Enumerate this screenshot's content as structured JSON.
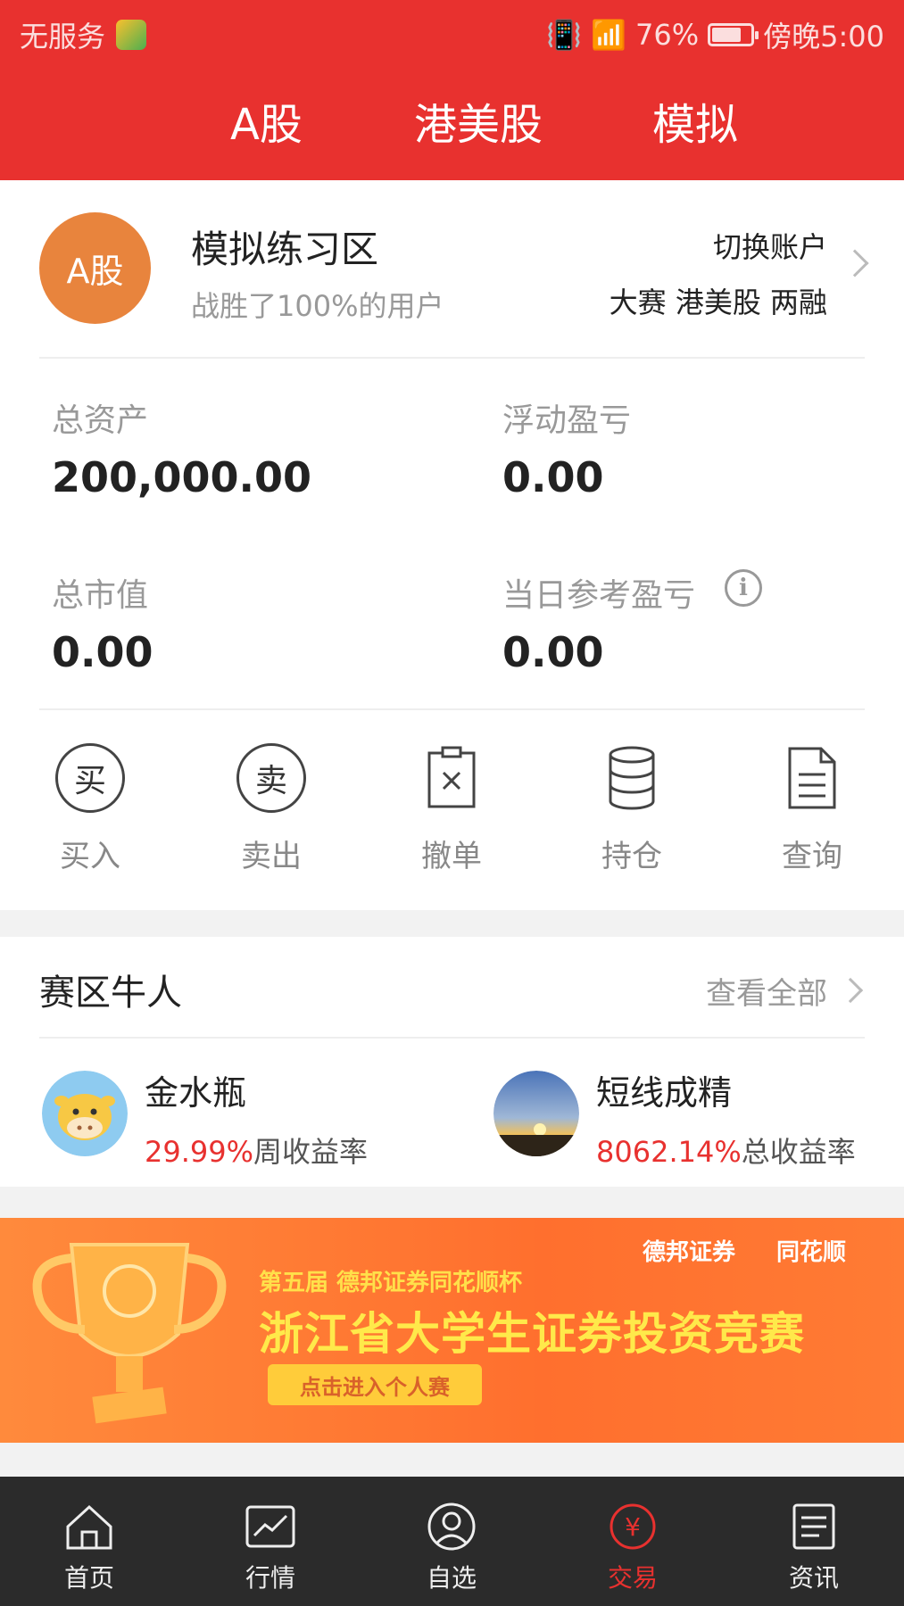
{
  "status_bar": {
    "carrier": "无服务",
    "battery": "76%",
    "battery_level": 0.76,
    "time": "傍晚5:00"
  },
  "top_tabs": [
    "A股",
    "港美股",
    "模拟"
  ],
  "account": {
    "avatar_text": "A股",
    "title": "模拟练习区",
    "subtitle": "战胜了100%的用户",
    "switch_label": "切换账户",
    "switch_options": "大赛 港美股 两融"
  },
  "metrics": {
    "total_assets_label": "总资产",
    "total_assets": "200,000.00",
    "float_pl_label": "浮动盈亏",
    "float_pl": "0.00",
    "market_value_label": "总市值",
    "market_value": "0.00",
    "daily_pl_label": "当日参考盈亏",
    "daily_pl": "0.00"
  },
  "actions": [
    {
      "icon": "buy-icon",
      "glyph": "买",
      "label": "买入"
    },
    {
      "icon": "sell-icon",
      "glyph": "卖",
      "label": "卖出"
    },
    {
      "icon": "cancel-order-icon",
      "label": "撤单"
    },
    {
      "icon": "holdings-icon",
      "label": "持仓"
    },
    {
      "icon": "query-icon",
      "label": "查询"
    }
  ],
  "experts": {
    "title": "赛区牛人",
    "view_all": "查看全部",
    "items": [
      {
        "name": "金水瓶",
        "rate": "29.99%",
        "rate_label": "周收益率"
      },
      {
        "name": "短线成精",
        "rate": "8062.14%",
        "rate_label": "总收益率"
      }
    ]
  },
  "banner": {
    "brand1": "德邦证券",
    "brand2": "同花顺",
    "subtitle": "第五届 德邦证券同花顺杯",
    "headline": "浙江省大学生证券投资竞赛",
    "cta": "点击进入个人赛"
  },
  "bottom_nav": [
    {
      "icon": "home-icon",
      "label": "首页"
    },
    {
      "icon": "market-icon",
      "label": "行情"
    },
    {
      "icon": "watchlist-icon",
      "label": "自选"
    },
    {
      "icon": "trade-icon",
      "label": "交易",
      "active": true
    },
    {
      "icon": "news-icon",
      "label": "资讯"
    }
  ],
  "colors": {
    "brand_red": "#e8312f",
    "avatar_orange": "#e8843d",
    "banner_orange": "#ff6f2e"
  }
}
